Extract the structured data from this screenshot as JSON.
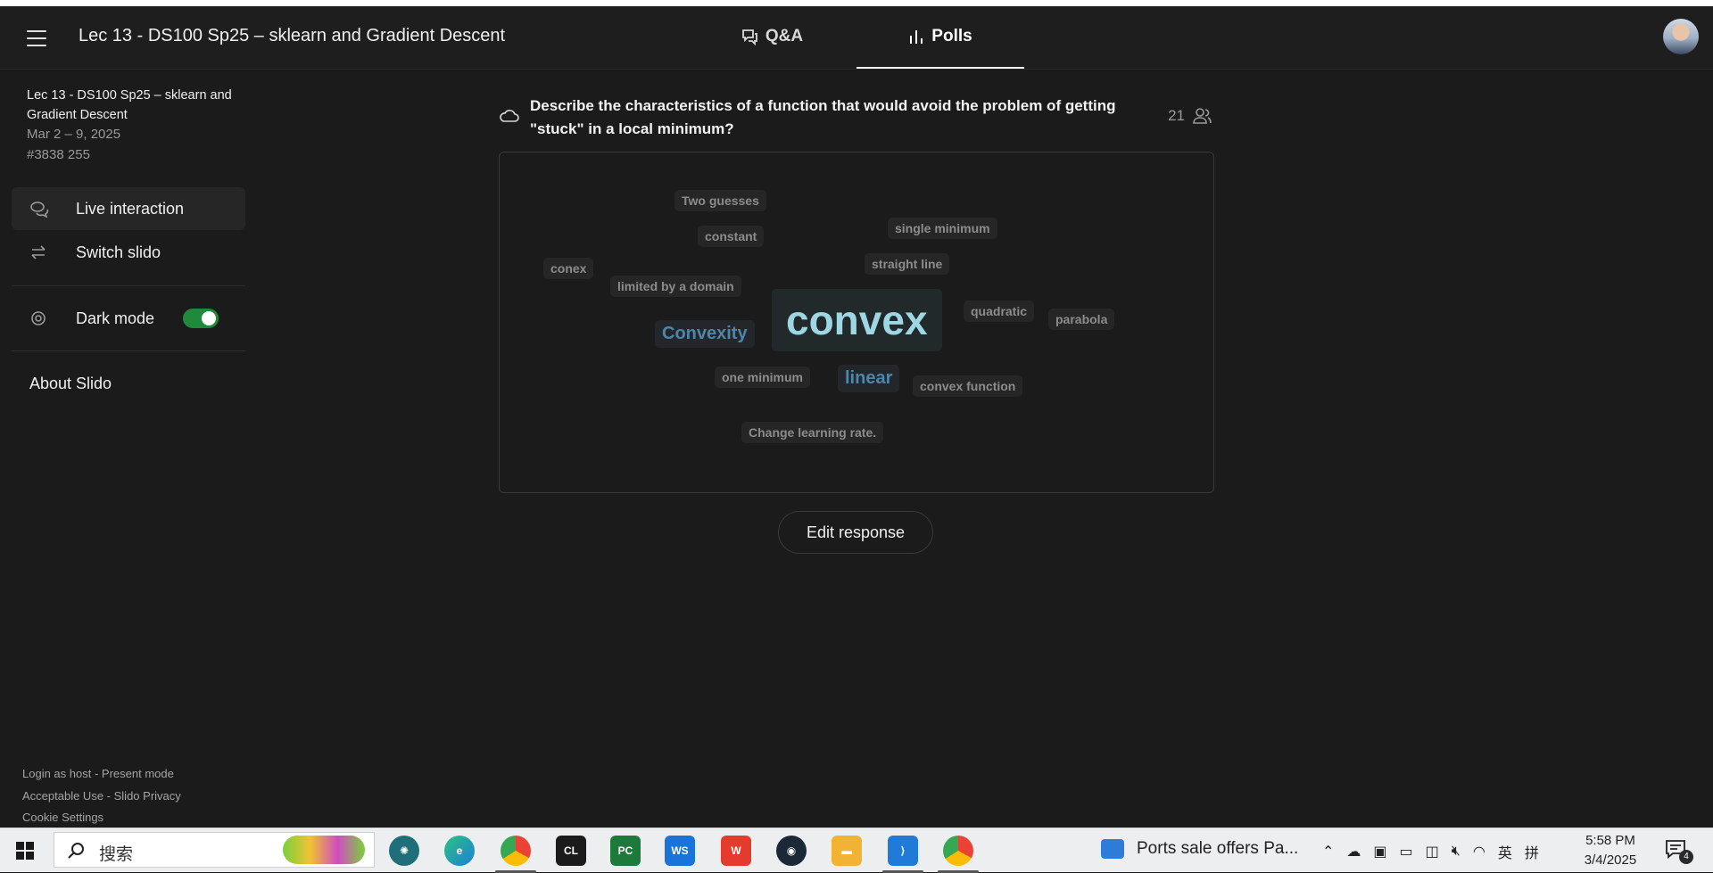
{
  "header": {
    "menu_icon": "hamburger-menu-icon",
    "title": "Lec 13 - DS100 Sp25 – sklearn and Gradient Descent",
    "tabs": [
      {
        "label": "Q&A",
        "icon": "chat-bubble-icon"
      },
      {
        "label": "Polls",
        "icon": "bar-chart-icon"
      }
    ],
    "active_tab": "Polls"
  },
  "sidebar": {
    "event_title": "Lec 13 - DS100 Sp25 – sklearn and Gradient Descent",
    "date_range": "Mar 2 – 9, 2025",
    "event_code": "#3838 255",
    "items": [
      {
        "label": "Live interaction",
        "icon": "chat-bubbles-icon"
      },
      {
        "label": "Switch slido",
        "icon": "swap-arrows-icon"
      }
    ],
    "dark_mode": {
      "label": "Dark mode",
      "on": true
    },
    "about": "About Slido",
    "footer": {
      "login_host": "Login as host",
      "sep1": " - ",
      "present_mode": "Present mode",
      "acceptable_use": "Acceptable Use",
      "sep2": " - ",
      "privacy": "Slido Privacy",
      "cookie": "Cookie Settings"
    }
  },
  "poll": {
    "question": "Describe the characteristics of a function that would avoid the problem of getting \"stuck\" in a local minimum?",
    "participants": "21",
    "words": [
      "Two guesses",
      "constant",
      "single minimum",
      "conex",
      "straight line",
      "limited by a domain",
      "convex",
      "quadratic",
      "parabola",
      "Convexity",
      "one minimum",
      "linear",
      "convex function",
      "Change learning rate."
    ],
    "edit_label": "Edit response"
  },
  "taskbar": {
    "search_placeholder": "搜索",
    "apps": [
      "brain-app-icon",
      "edge-browser-icon",
      "chrome-browser-icon",
      "clion-icon",
      "pycharm-icon",
      "webstorm-icon",
      "wps-office-icon",
      "steam-icon",
      "file-explorer-icon",
      "vscode-icon",
      "chrome-profile-icon"
    ],
    "news": "Ports sale offers Pa...",
    "ime": "英",
    "ime_mode": "拼",
    "time": "5:58 PM",
    "date": "3/4/2025",
    "notifications": "4"
  }
}
